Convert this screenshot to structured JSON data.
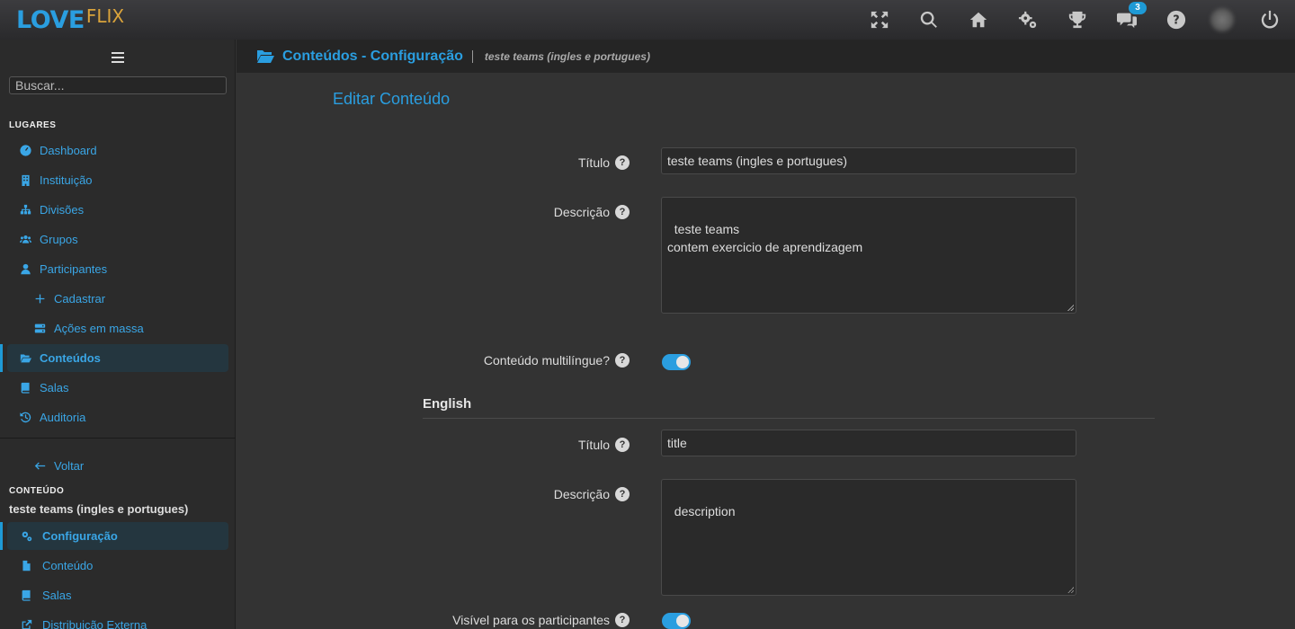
{
  "app": {
    "logo_primary": "LOVE",
    "logo_secondary": "FLIX",
    "notifications_count": "3"
  },
  "topbar": {
    "icons": [
      "fullscreen-icon",
      "search-icon",
      "home-icon",
      "gears-icon",
      "trophy-icon",
      "chat-icon",
      "help-icon",
      "avatar",
      "power-icon"
    ]
  },
  "sidebar": {
    "search_placeholder": "Buscar...",
    "places_heading": "LUGARES",
    "places": [
      {
        "label": "Dashboard",
        "icon": "dashboard-icon"
      },
      {
        "label": "Instituição",
        "icon": "building-icon"
      },
      {
        "label": "Divisões",
        "icon": "sitemap-icon"
      },
      {
        "label": "Grupos",
        "icon": "users-icon"
      },
      {
        "label": "Participantes",
        "icon": "user-icon"
      },
      {
        "label": "Cadastrar",
        "icon": "plus-icon"
      },
      {
        "label": "Ações em massa",
        "icon": "server-icon"
      },
      {
        "label": "Conteúdos",
        "icon": "folder-open-icon",
        "active": true
      },
      {
        "label": "Salas",
        "icon": "book-icon"
      },
      {
        "label": "Auditoria",
        "icon": "history-icon"
      }
    ],
    "back_label": "Voltar",
    "content_heading": "CONTEÚDO",
    "content_name": "teste teams (ingles e portugues)",
    "content_items": [
      {
        "label": "Configuração",
        "icon": "gears-icon",
        "active": true
      },
      {
        "label": "Conteúdo",
        "icon": "file-icon"
      },
      {
        "label": "Salas",
        "icon": "book-icon"
      },
      {
        "label": "Distribuição Externa",
        "icon": "external-link-icon"
      }
    ]
  },
  "header": {
    "title": "Conteúdos - Configuração",
    "subtitle": "teste teams (ingles e portugues)"
  },
  "form": {
    "title": "Editar Conteúdo",
    "titulo_label": "Título",
    "titulo_value": "teste teams (ingles e portugues)",
    "descricao_label": "Descrição",
    "descricao_value": "teste teams\ncontem exercicio de aprendizagem",
    "multilingual_label": "Conteúdo multilíngue?",
    "multilingual_on": true,
    "english_heading": "English",
    "en_titulo_label": "Título",
    "en_titulo_value": "title",
    "en_descricao_label": "Descrição",
    "en_descricao_value": "description",
    "visible_label": "Visível para os participantes",
    "visible_on": true,
    "help_glyph": "?"
  },
  "colors": {
    "accent": "#2a9ee0",
    "logo_secondary": "#d9a33b",
    "background": "#333333",
    "sidebar": "#2b2b2b"
  }
}
